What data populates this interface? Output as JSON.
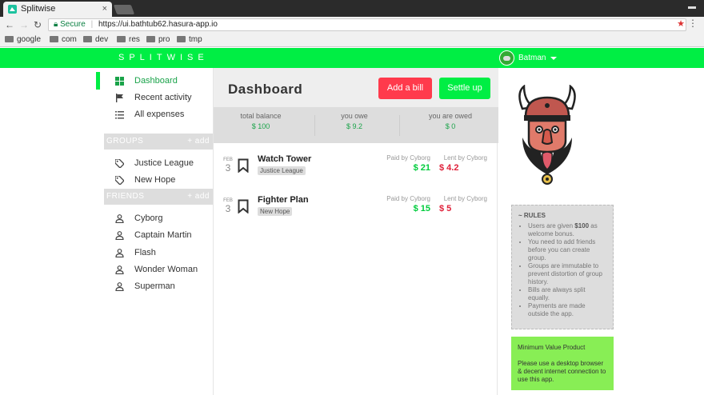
{
  "browser": {
    "tab_title": "Splitwise",
    "tab_close": "×",
    "secure_label": "Secure",
    "url": "https://ui.bathtub62.hasura-app.io",
    "bookmarks": [
      "google",
      "com",
      "dev",
      "res",
      "pro",
      "tmp"
    ]
  },
  "app": {
    "brand": "SPLITWISE",
    "user_name": "Batman"
  },
  "sidebar": {
    "nav": [
      {
        "label": "Dashboard",
        "icon": "dashboard-grid-icon"
      },
      {
        "label": "Recent activity",
        "icon": "flag-icon"
      },
      {
        "label": "All expenses",
        "icon": "list-icon"
      }
    ],
    "groups_header": "GROUPS",
    "groups_add": "+ add",
    "groups": [
      "Justice League",
      "New Hope"
    ],
    "friends_header": "FRIENDS",
    "friends_add": "+ add",
    "friends": [
      "Cyborg",
      "Captain Martin",
      "Flash",
      "Wonder Woman",
      "Superman"
    ]
  },
  "dashboard": {
    "title": "Dashboard",
    "add_bill": "Add a bill",
    "settle_up": "Settle up",
    "balances": [
      {
        "label": "total balance",
        "value": "$ 100"
      },
      {
        "label": "you owe",
        "value": "$ 9.2"
      },
      {
        "label": "you are owed",
        "value": "$ 0"
      }
    ],
    "expenses": [
      {
        "month": "FEB",
        "day": "3",
        "title": "Watch Tower",
        "group": "Justice League",
        "paid_label": "Paid by Cyborg",
        "paid_amount": "$ 21",
        "lent_label": "Lent by Cyborg",
        "lent_amount": "$ 4.2"
      },
      {
        "month": "FEB",
        "day": "3",
        "title": "Fighter Plan",
        "group": "New Hope",
        "paid_label": "Paid by Cyborg",
        "paid_amount": "$ 15",
        "lent_label": "Lent by Cyborg",
        "lent_amount": "$ 5"
      }
    ]
  },
  "rules": {
    "heading": "~ RULES",
    "items": [
      {
        "pre": "Users are given ",
        "bold": "$100",
        "post": " as welcome bonus."
      },
      {
        "pre": "You need to add friends before you can create group.",
        "bold": "",
        "post": ""
      },
      {
        "pre": "Groups are immutable to prevent distortion of group history.",
        "bold": "",
        "post": ""
      },
      {
        "pre": "Bills are always split equally.",
        "bold": "",
        "post": ""
      },
      {
        "pre": "Payments are made outside the app.",
        "bold": "",
        "post": ""
      }
    ]
  },
  "mvp": {
    "heading": "Minimum Value Product",
    "body": "Please use a desktop browser & decent internet connection to use this app."
  },
  "colors": {
    "brand_green": "#00ee44",
    "danger_red": "#ff3a4c"
  }
}
